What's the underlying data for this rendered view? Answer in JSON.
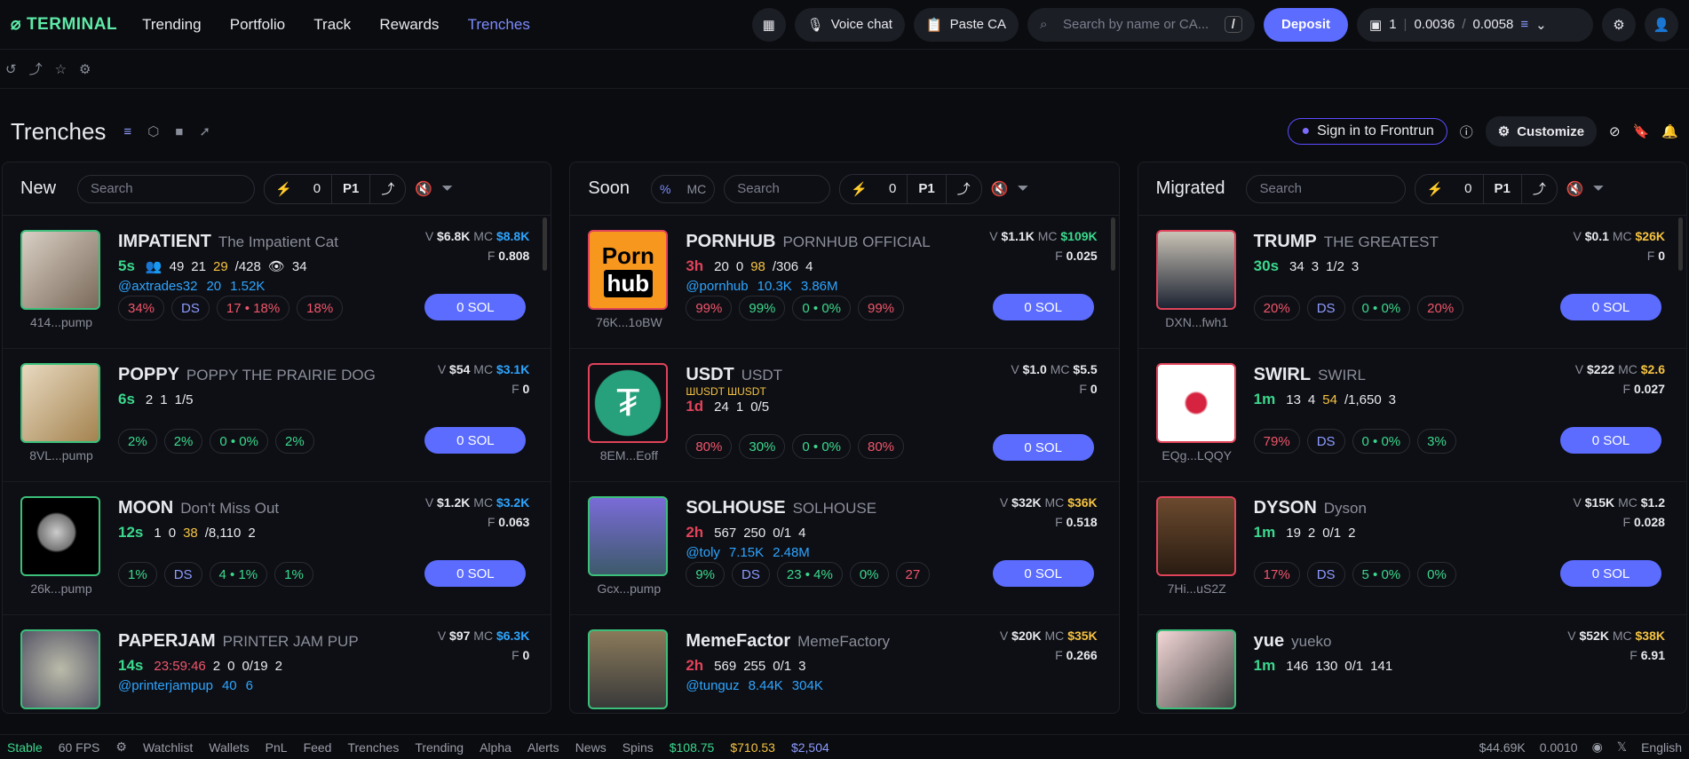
{
  "topbar": {
    "logo": "TERMINAL",
    "nav": [
      "Trending",
      "Portfolio",
      "Track",
      "Rewards",
      "Trenches"
    ],
    "voice_chat": "Voice chat",
    "paste_ca": "Paste CA",
    "search_placeholder": "Search by name or CA...",
    "search_shortcut": "/",
    "deposit": "Deposit",
    "wallet_count": "1",
    "wallet_bal_a": "0.0036",
    "wallet_bal_b": "0.0058"
  },
  "header": {
    "title": "Trenches",
    "frontrun": "Sign in to Frontrun",
    "customize": "Customize"
  },
  "columns": [
    {
      "title": "New",
      "search_placeholder": "Search",
      "count": "0",
      "page": "P1",
      "cards": [
        {
          "ticker": "IMPATIENT",
          "name": "The Impatient Cat",
          "addr": "414...pump",
          "age": "5s",
          "holders": "49",
          "vol": "21",
          "pro": "29",
          "pro_total": "/428",
          "views": "34",
          "twitter": "@axtrades32",
          "t1": "20",
          "t2": "1.52K",
          "v": "$6.8K",
          "mc": "$8.8K",
          "f": "0.808",
          "s1": "34%",
          "s2": "DS",
          "s3": "17 • 18%",
          "s4": "18%",
          "buy": "0 SOL"
        },
        {
          "ticker": "POPPY",
          "name": "POPPY THE PRAIRIE DOG",
          "addr": "8VL...pump",
          "age": "6s",
          "holders": "2",
          "vol": "1",
          "pro": "1/5",
          "v": "$54",
          "mc": "$3.1K",
          "f": "0",
          "s1": "2%",
          "s2": "2%",
          "s3": "0 • 0%",
          "s4": "2%",
          "buy": "0 SOL"
        },
        {
          "ticker": "MOON",
          "name": "Don't Miss Out",
          "addr": "26k...pump",
          "age": "12s",
          "holders": "1",
          "vol": "0",
          "pro": "38",
          "pro_total": "/8,110",
          "views": "2",
          "v": "$1.2K",
          "mc": "$3.2K",
          "f": "0.063",
          "s1": "1%",
          "s2": "DS",
          "s3": "4 • 1%",
          "s4": "1%",
          "s5": "1%",
          "buy": "0 SOL"
        },
        {
          "ticker": "PAPERJAM",
          "name": "PRINTER JAM PUP",
          "age": "14s",
          "timer": "23:59:46",
          "holders": "2",
          "vol": "0",
          "pro": "0/19",
          "views": "2",
          "twitter": "@printerjampup",
          "t1": "40",
          "t2": "6",
          "v": "$97",
          "mc": "$6.3K",
          "f": "0"
        }
      ]
    },
    {
      "title": "Soon",
      "search_placeholder": "Search",
      "count": "0",
      "page": "P1",
      "pct": "%",
      "mcl": "MC",
      "cards": [
        {
          "ticker": "PORNHUB",
          "name": "PORNHUB OFFICIAL",
          "addr": "76K...1oBW",
          "age": "3h",
          "holders": "20",
          "vol": "0",
          "pro": "98",
          "pro_total": "/306",
          "views": "4",
          "twitter": "@pornhub",
          "t1": "10.3K",
          "t2": "3.86M",
          "v": "$1.1K",
          "mc": "$109K",
          "f": "0.025",
          "s1": "99%",
          "s2": "99%",
          "s3": "0 • 0%",
          "s4": "99%",
          "buy": "0 SOL",
          "logo_a": "Porn",
          "logo_b": "hub"
        },
        {
          "ticker": "USDT",
          "name": "USDT",
          "sub": "ШUSDT ШUSDT",
          "addr": "8EM...Eoff",
          "age": "1d",
          "holders": "24",
          "vol": "1",
          "pro": "0/5",
          "v": "$1.0",
          "mc": "$5.5",
          "f": "0",
          "s1": "80%",
          "s2": "30%",
          "s3": "0 • 0%",
          "s4": "80%",
          "buy": "0 SOL"
        },
        {
          "ticker": "SOLHOUSE",
          "name": "SOLHOUSE",
          "addr": "Gcx...pump",
          "age": "2h",
          "holders": "567",
          "vol": "250",
          "pro": "0/1",
          "views": "4",
          "twitter": "@toly",
          "t1": "7.15K",
          "t2": "2.48M",
          "v": "$32K",
          "mc": "$36K",
          "f": "0.518",
          "s1": "9%",
          "s2": "DS",
          "s3": "23 • 4%",
          "s4": "0%",
          "s5": "27",
          "buy": "0 SOL"
        },
        {
          "ticker": "MemeFactor",
          "name": "MemeFactory",
          "age": "2h",
          "holders": "569",
          "vol": "255",
          "pro": "0/1",
          "views": "3",
          "twitter": "@tunguz",
          "t1": "8.44K",
          "t2": "304K",
          "v": "$20K",
          "mc": "$35K",
          "f": "0.266"
        }
      ]
    },
    {
      "title": "Migrated",
      "search_placeholder": "Search",
      "count": "0",
      "page": "P1",
      "cards": [
        {
          "ticker": "TRUMP",
          "name": "THE GREATEST",
          "addr": "DXN...fwh1",
          "age": "30s",
          "holders": "34",
          "vol": "3",
          "pro": "1/2",
          "views": "3",
          "v": "$0.1",
          "mc": "$26K",
          "f": "0",
          "s1": "20%",
          "s2": "DS",
          "s3": "0 • 0%",
          "s4": "20%",
          "buy": "0 SOL"
        },
        {
          "ticker": "SWIRL",
          "name": "SWIRL",
          "addr": "EQg...LQQY",
          "age": "1m",
          "holders": "13",
          "vol": "4",
          "pro": "54",
          "pro_total": "/1,650",
          "views": "3",
          "v": "$222",
          "mc": "$2.6",
          "f": "0.027",
          "s1": "79%",
          "s2": "DS",
          "s3": "0 • 0%",
          "s4": "3%",
          "buy": "0 SOL"
        },
        {
          "ticker": "DYSON",
          "name": "Dyson",
          "addr": "7Hi...uS2Z",
          "age": "1m",
          "holders": "19",
          "vol": "2",
          "pro": "0/1",
          "views": "2",
          "v": "$15K",
          "mc": "$1.2",
          "f": "0.028",
          "s1": "17%",
          "s2": "DS",
          "s3": "5 • 0%",
          "s4": "0%",
          "buy": "0 SOL"
        },
        {
          "ticker": "yue",
          "name": "yueko",
          "age": "1m",
          "holders": "146",
          "vol": "130",
          "pro": "0/1",
          "views": "141",
          "v": "$52K",
          "mc": "$38K",
          "f": "6.91"
        }
      ]
    }
  ],
  "statusbar": {
    "stable": "Stable",
    "fps": "60 FPS",
    "watchlist": "Watchlist",
    "wallets": "Wallets",
    "pnl": "PnL",
    "feed": "Feed",
    "trenches": "Trenches",
    "trending": "Trending",
    "alpha": "Alpha",
    "alerts": "Alerts",
    "news": "News",
    "spins": "Spins",
    "sol": "$108.75",
    "bnb": "$710.53",
    "eth": "$2,504",
    "liq": "$44.69K",
    "gas": "0.0010",
    "lang": "English"
  }
}
